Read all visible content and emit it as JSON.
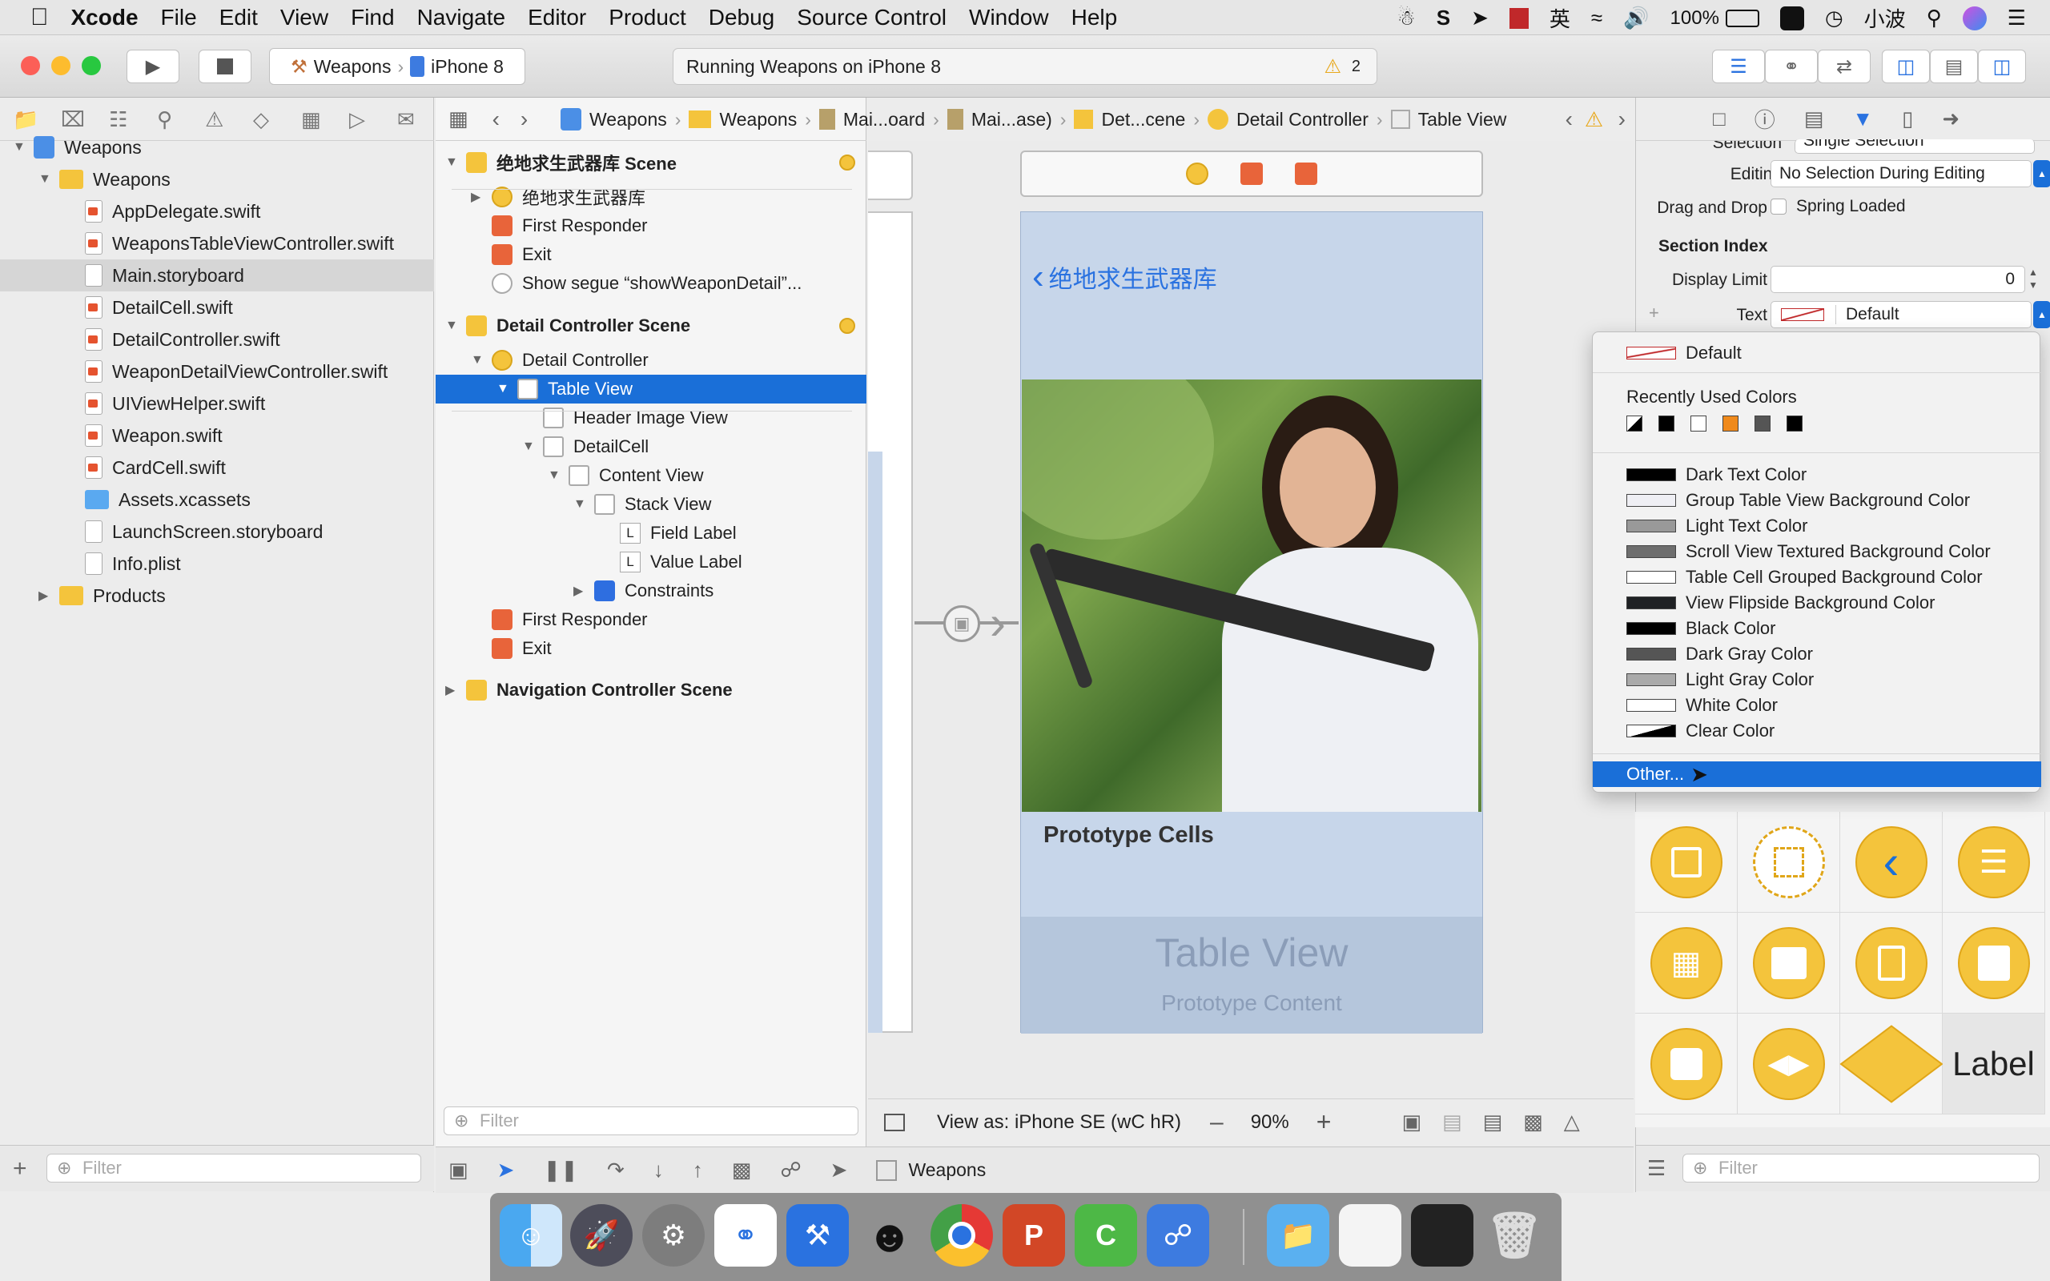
{
  "menubar": {
    "apple": "",
    "app": "Xcode",
    "items": [
      "File",
      "Edit",
      "View",
      "Find",
      "Navigate",
      "Editor",
      "Product",
      "Debug",
      "Source Control",
      "Window",
      "Help"
    ],
    "ime": "英",
    "battery": "100%",
    "user": "小波"
  },
  "toolbar": {
    "scheme": "Weapons",
    "device": "iPhone 8",
    "activity": "Running Weapons on iPhone 8",
    "warnings": "2"
  },
  "jumpbar": [
    "Weapons",
    "Weapons",
    "Mai...oard",
    "Mai...ase)",
    "Det...cene",
    "Detail Controller",
    "Table View"
  ],
  "navigator": {
    "items": [
      {
        "label": "Weapons",
        "kind": "project",
        "indent": 0
      },
      {
        "label": "Weapons",
        "kind": "folder",
        "indent": 1
      },
      {
        "label": "AppDelegate.swift",
        "kind": "swift",
        "indent": 2
      },
      {
        "label": "WeaponsTableViewController.swift",
        "kind": "swift",
        "indent": 2
      },
      {
        "label": "Main.storyboard",
        "kind": "storyboard",
        "indent": 2
      },
      {
        "label": "DetailCell.swift",
        "kind": "swift",
        "indent": 2
      },
      {
        "label": "DetailController.swift",
        "kind": "swift",
        "indent": 2
      },
      {
        "label": "WeaponDetailViewController.swift",
        "kind": "swift",
        "indent": 2
      },
      {
        "label": "UIViewHelper.swift",
        "kind": "swift",
        "indent": 2
      },
      {
        "label": "Weapon.swift",
        "kind": "swift",
        "indent": 2
      },
      {
        "label": "CardCell.swift",
        "kind": "swift",
        "indent": 2
      },
      {
        "label": "Assets.xcassets",
        "kind": "assets",
        "indent": 2
      },
      {
        "label": "LaunchScreen.storyboard",
        "kind": "storyboard",
        "indent": 2
      },
      {
        "label": "Info.plist",
        "kind": "plist",
        "indent": 2
      },
      {
        "label": "Products",
        "kind": "folder",
        "indent": 1
      }
    ],
    "filter_placeholder": "Filter"
  },
  "outline": {
    "rows": [
      {
        "label": "绝地求生武器库 Scene",
        "kind": "scene",
        "bold": true
      },
      {
        "label": "绝地求生武器库",
        "kind": "vc"
      },
      {
        "label": "First Responder",
        "kind": "responder"
      },
      {
        "label": "Exit",
        "kind": "exit"
      },
      {
        "label": "Show segue “showWeaponDetail”...",
        "kind": "segue"
      },
      {
        "label": "Detail Controller Scene",
        "kind": "scene",
        "bold": true
      },
      {
        "label": "Detail Controller",
        "kind": "vc"
      },
      {
        "label": "Table View",
        "kind": "view"
      },
      {
        "label": "Header Image View",
        "kind": "view"
      },
      {
        "label": "DetailCell",
        "kind": "view"
      },
      {
        "label": "Content View",
        "kind": "view"
      },
      {
        "label": "Stack View",
        "kind": "view"
      },
      {
        "label": "Field Label",
        "kind": "label"
      },
      {
        "label": "Value Label",
        "kind": "label"
      },
      {
        "label": "Constraints",
        "kind": "constraints"
      },
      {
        "label": "First Responder",
        "kind": "responder"
      },
      {
        "label": "Exit",
        "kind": "exit"
      },
      {
        "label": "Navigation Controller Scene",
        "kind": "scene",
        "bold": true
      }
    ],
    "filter_placeholder": "Filter"
  },
  "canvas": {
    "back_title": "绝地求生武器库",
    "prototype_cells": "Prototype Cells",
    "table_view": "Table View",
    "prototype_content": "Prototype Content",
    "view_as": "View as: iPhone SE (wC hR)",
    "zoom": "90%",
    "debug_target": "Weapons"
  },
  "inspector": {
    "selection_label": "Selection",
    "selection_value": "Single Selection",
    "editing_label": "Editing",
    "editing_value": "No Selection During Editing",
    "drag_label": "Drag and Drop",
    "spring_loaded": "Spring Loaded",
    "section_index": "Section Index",
    "display_limit_label": "Display Limit",
    "display_limit_value": "0",
    "text_label": "Text",
    "text_value": "Default",
    "filter_placeholder": "Filter"
  },
  "color_popup": {
    "default": "Default",
    "recent_title": "Recently Used Colors",
    "recent_colors": [
      "#ffffff",
      "#000000",
      "#ffffff",
      "#f08a1c",
      "#555555",
      "#000000"
    ],
    "items": [
      {
        "label": "Dark Text Color",
        "color": "#000000"
      },
      {
        "label": "Group Table View Background Color",
        "color": "#efeff4"
      },
      {
        "label": "Light Text Color",
        "color": "#999999"
      },
      {
        "label": "Scroll View Textured Background Color",
        "color": "#6e6e6e"
      },
      {
        "label": "Table Cell Grouped Background Color",
        "color": "#ffffff"
      },
      {
        "label": "View Flipside Background Color",
        "color": "#1f2124"
      },
      {
        "label": "Black Color",
        "color": "#000000"
      },
      {
        "label": "Dark Gray Color",
        "color": "#555555"
      },
      {
        "label": "Light Gray Color",
        "color": "#aaaaaa"
      },
      {
        "label": "White Color",
        "color": "#ffffff"
      },
      {
        "label": "Clear Color",
        "color": "clear"
      }
    ],
    "other": "Other..."
  },
  "library": {
    "label_cell": "Label"
  },
  "colors": {
    "selection_blue": "#1a6fd8",
    "folder_yellow": "#f4c43c",
    "phone_bg": "#c7d6ea"
  }
}
